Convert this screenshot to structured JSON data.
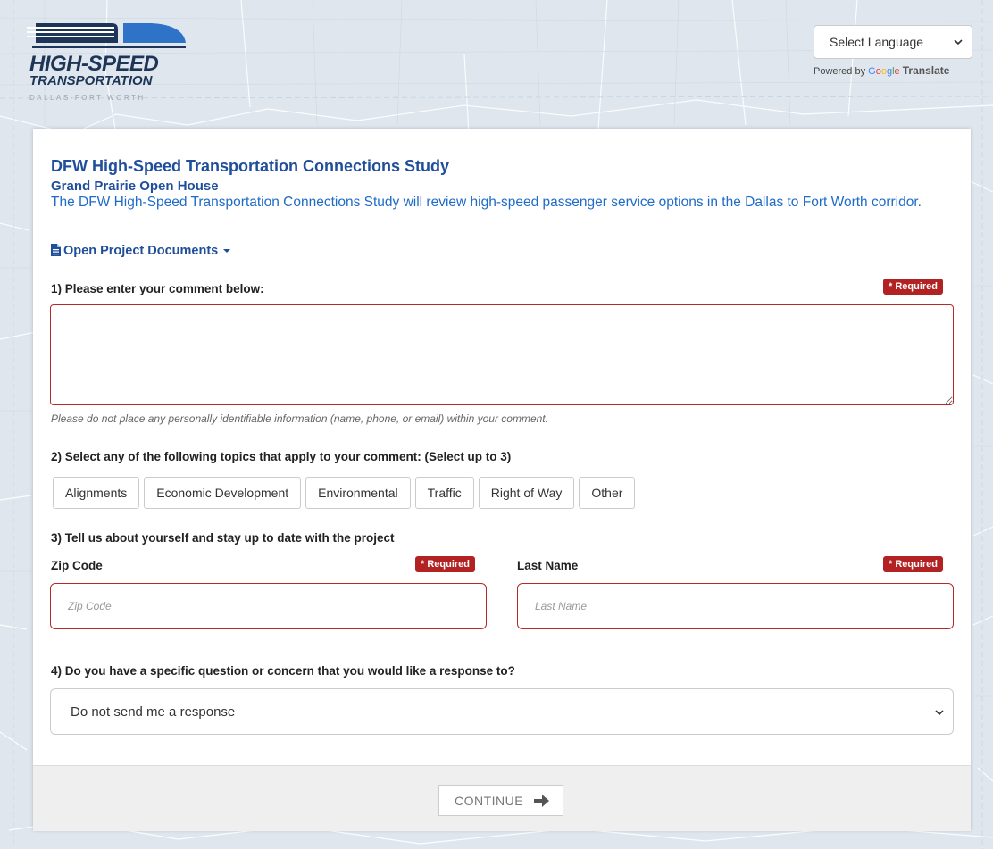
{
  "brand": {
    "line1": "HIGH-SPEED",
    "line2": "TRANSPORTATION",
    "line3": "DALLAS-FORT WORTH"
  },
  "translate": {
    "select_label": "Select Language",
    "powered_by": "Powered by",
    "google_letters": [
      "G",
      "o",
      "o",
      "g",
      "l",
      "e"
    ],
    "translate_word": "Translate"
  },
  "header": {
    "title": "DFW High-Speed Transportation Connections Study",
    "subtitle": "Grand Prairie Open House",
    "description": "The DFW High-Speed Transportation Connections Study will review high-speed passenger service options in the Dallas to Fort Worth corridor.",
    "documents_link": "Open Project Documents"
  },
  "form": {
    "required_label": "* Required",
    "q1": {
      "label": "1) Please enter your comment below:",
      "value": "",
      "hint": "Please do not place any personally identifiable information (name, phone, or email) within your comment."
    },
    "q2": {
      "label": "2) Select any of the following topics that apply to your comment: (Select up to 3)",
      "topics": [
        "Alignments",
        "Economic Development",
        "Environmental",
        "Traffic",
        "Right of Way",
        "Other"
      ]
    },
    "q3": {
      "label": "3) Tell us about yourself and stay up to date with the project",
      "zip_label": "Zip Code",
      "zip_placeholder": "Zip Code",
      "last_name_label": "Last Name",
      "last_name_placeholder": "Last Name"
    },
    "q4": {
      "label": "4) Do you have a specific question or concern that you would like a response to?",
      "selected": "Do not send me a response"
    }
  },
  "footer": {
    "continue_label": "CONTINUE"
  },
  "colors": {
    "title_blue": "#1f4e9b",
    "desc_blue": "#1f6bc8",
    "required_red": "#b22222",
    "map_bg": "#dfe6ee"
  }
}
